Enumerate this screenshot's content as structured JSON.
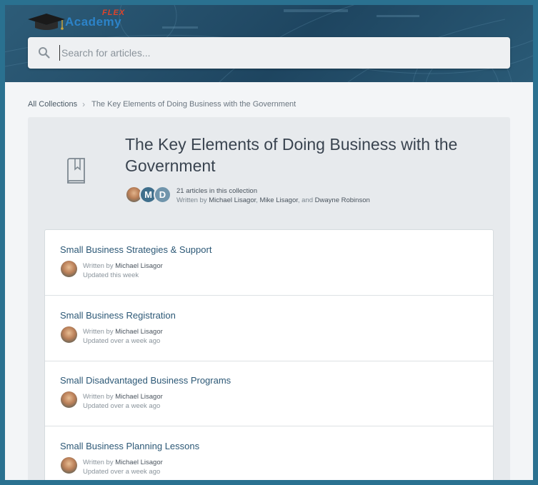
{
  "brand": {
    "logo_top": "FLEX",
    "logo_main": "Academy"
  },
  "search": {
    "placeholder": "Search for articles...",
    "value": ""
  },
  "breadcrumb": {
    "root": "All Collections",
    "separator": "›",
    "current": "The Key Elements of Doing Business with the Government"
  },
  "collection": {
    "title": "The Key Elements of Doing Business with the Government",
    "icon": "book-bookmark-icon",
    "avatars": [
      "photo",
      "M",
      "D"
    ],
    "count_text": "21 articles in this collection",
    "written_by_prefix": "Written by",
    "author_1": "Michael Lisagor",
    "author_2": "Mike Lisagor",
    "authors_and": ", and",
    "author_3": "Dwayne Robinson"
  },
  "articles": [
    {
      "title": "Small Business Strategies & Support",
      "written_by": "Written by",
      "author": "Michael Lisagor",
      "updated": "Updated this week"
    },
    {
      "title": "Small Business Registration",
      "written_by": "Written by",
      "author": "Michael Lisagor",
      "updated": "Updated over a week ago"
    },
    {
      "title": "Small Disadvantaged Business Programs",
      "written_by": "Written by",
      "author": "Michael Lisagor",
      "updated": "Updated over a week ago"
    },
    {
      "title": "Small Business Planning Lessons",
      "written_by": "Written by",
      "author": "Michael Lisagor",
      "updated": "Updated over a week ago"
    }
  ],
  "colors": {
    "frame": "#2a7190",
    "header": "#1e4560",
    "link": "#2c5876"
  }
}
